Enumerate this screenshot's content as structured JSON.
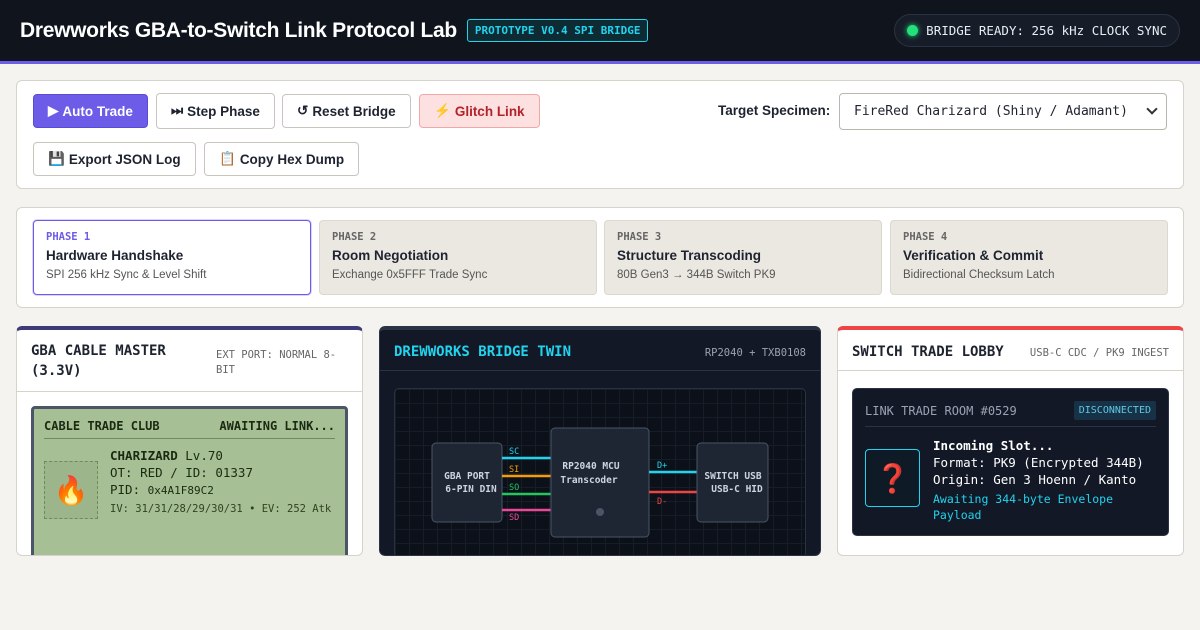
{
  "header": {
    "title": "Drewworks GBA-to-Switch Link Protocol Lab",
    "badge": "PROTOTYPE V0.4 SPI BRIDGE",
    "status": "BRIDGE READY: 256 kHz CLOCK SYNC",
    "status_color": "#22e07a",
    "accent": "#6c5ce7"
  },
  "controls": {
    "auto_trade": {
      "icon": "▶",
      "label": "Auto Trade"
    },
    "step_phase": {
      "icon": "⏭",
      "label": "Step Phase"
    },
    "reset_bridge": {
      "icon": "↺",
      "label": "Reset Bridge"
    },
    "glitch_link": {
      "icon": "⚡",
      "label": "Glitch Link"
    },
    "export_json": {
      "icon": "💾",
      "label": "Export JSON Log"
    },
    "copy_hex": {
      "icon": "📋",
      "label": "Copy Hex Dump"
    },
    "specimen_label": "Target Specimen:",
    "specimen_value": "FireRed Charizard (Shiny / Adamant)"
  },
  "phases": [
    {
      "num": "PHASE 1",
      "title": "Hardware Handshake",
      "sub": "SPI 256 kHz Sync & Level Shift",
      "active": true
    },
    {
      "num": "PHASE 2",
      "title": "Room Negotiation",
      "sub": "Exchange 0x5FFF Trade Sync",
      "active": false
    },
    {
      "num": "PHASE 3",
      "title": "Structure Transcoding",
      "sub": "80B Gen3 → 344B Switch PK9",
      "active": false
    },
    {
      "num": "PHASE 4",
      "title": "Verification & Commit",
      "sub": "Bidirectional Checksum Latch",
      "active": false
    }
  ],
  "gba": {
    "title": "GBA CABLE MASTER (3.3V)",
    "meta": "EXT PORT: NORMAL 8-BIT",
    "lcd_club": "CABLE TRADE CLUB",
    "lcd_status": "AWAITING LINK...",
    "sprite_icon": "fire-icon",
    "name": "CHARIZARD",
    "level": "Lv.70",
    "ot": "OT: RED / ID: 01337",
    "pid_label": "PID:",
    "pid": "0x4A1F89C2",
    "stats": "IV: 31/31/28/29/30/31 • EV: 252 Atk"
  },
  "bridge": {
    "title": "DREWWORKS BRIDGE TWIN",
    "meta": "RP2040 + TXB0108",
    "gba_port": [
      "GBA PORT",
      "6-PIN DIN"
    ],
    "mcu": [
      "RP2040 MCU",
      "Transcoder"
    ],
    "switch_port": [
      "SWITCH USB",
      "USB-C HID"
    ],
    "lines_left": [
      {
        "label": "SC",
        "color": "#22d3ee"
      },
      {
        "label": "SI",
        "color": "#f59e0b"
      },
      {
        "label": "SO",
        "color": "#22c55e"
      },
      {
        "label": "SD",
        "color": "#ec4899"
      }
    ],
    "lines_right": [
      {
        "label": "D+",
        "color": "#22d3ee"
      },
      {
        "label": "D-",
        "color": "#ef4444"
      }
    ]
  },
  "switch": {
    "title": "SWITCH TRADE LOBBY",
    "meta": "USB-C CDC / PK9 INGEST",
    "room": "LINK TRADE ROOM #0529",
    "room_status": "DISCONNECTED",
    "slot_icon": "question-icon",
    "slot_title": "Incoming Slot...",
    "format": "Format: PK9 (Encrypted 344B)",
    "origin": "Origin: Gen 3 Hoenn / Kanto",
    "awaiting": "Awaiting 344-byte Envelope Payload"
  }
}
